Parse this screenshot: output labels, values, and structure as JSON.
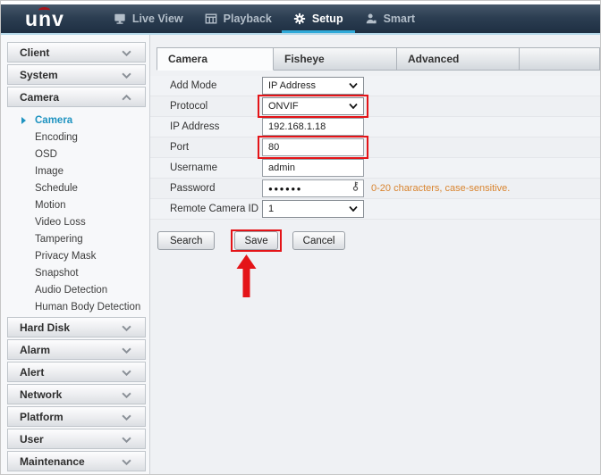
{
  "topnav": {
    "logo": "unv",
    "items": [
      {
        "label": "Live View"
      },
      {
        "label": "Playback"
      },
      {
        "label": "Setup"
      },
      {
        "label": "Smart"
      }
    ]
  },
  "sidebar": {
    "sections": [
      {
        "label": "Client"
      },
      {
        "label": "System"
      },
      {
        "label": "Camera"
      },
      {
        "label": "Hard Disk"
      },
      {
        "label": "Alarm"
      },
      {
        "label": "Alert"
      },
      {
        "label": "Network"
      },
      {
        "label": "Platform"
      },
      {
        "label": "User"
      },
      {
        "label": "Maintenance"
      }
    ],
    "camera_items": [
      {
        "label": "Camera"
      },
      {
        "label": "Encoding"
      },
      {
        "label": "OSD"
      },
      {
        "label": "Image"
      },
      {
        "label": "Schedule"
      },
      {
        "label": "Motion"
      },
      {
        "label": "Video Loss"
      },
      {
        "label": "Tampering"
      },
      {
        "label": "Privacy Mask"
      },
      {
        "label": "Snapshot"
      },
      {
        "label": "Audio Detection"
      },
      {
        "label": "Human Body Detection"
      }
    ]
  },
  "tabs": [
    {
      "label": "Camera"
    },
    {
      "label": "Fisheye"
    },
    {
      "label": "Advanced"
    }
  ],
  "form": {
    "add_mode": {
      "label": "Add Mode",
      "value": "IP Address"
    },
    "protocol": {
      "label": "Protocol",
      "value": "ONVIF"
    },
    "ip_address": {
      "label": "IP Address",
      "value": "192.168.1.18"
    },
    "port": {
      "label": "Port",
      "value": "80"
    },
    "username": {
      "label": "Username",
      "value": "admin"
    },
    "password": {
      "label": "Password",
      "value": "●●●●●●",
      "hint": "0-20 characters, case-sensitive."
    },
    "remote_camera_id": {
      "label": "Remote Camera ID",
      "value": "1"
    },
    "buttons": {
      "search": "Search",
      "save": "Save",
      "cancel": "Cancel"
    }
  },
  "colors": {
    "accent": "#2fa9d8",
    "annotation": "#e41418",
    "hint_text": "#d9842f",
    "active_link": "#1e93c0"
  }
}
